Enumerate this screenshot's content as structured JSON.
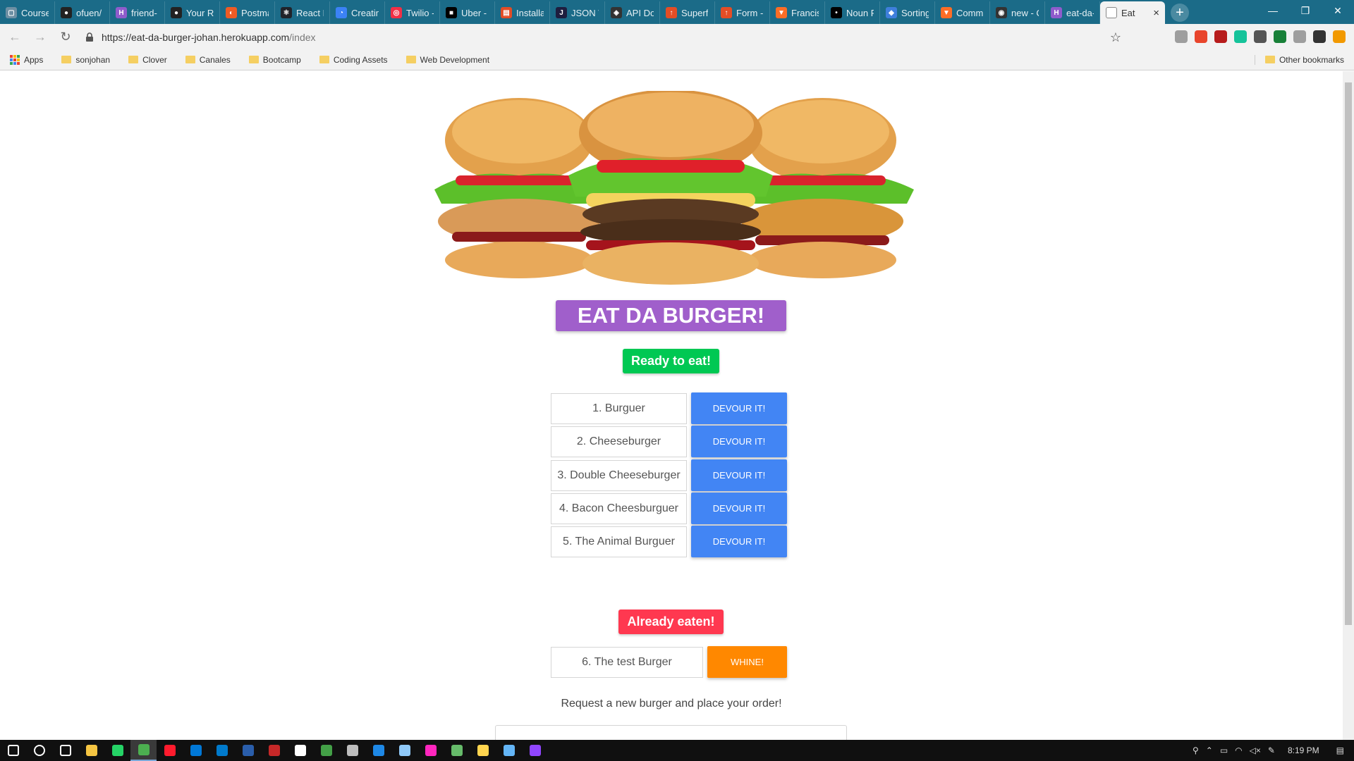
{
  "browser": {
    "tabs": [
      {
        "title": "Course",
        "color": "#6d8fa3",
        "glyph": "▢"
      },
      {
        "title": "ofuen/",
        "color": "#222222",
        "glyph": "●"
      },
      {
        "title": "friend-",
        "color": "#8f5ccc",
        "glyph": "H"
      },
      {
        "title": "Your Re",
        "color": "#222222",
        "glyph": "●"
      },
      {
        "title": "Postma",
        "color": "#ef5b25",
        "glyph": "◐"
      },
      {
        "title": "React R",
        "color": "#20232a",
        "glyph": "⚛"
      },
      {
        "title": "Creatin",
        "color": "#3b82f6",
        "glyph": "◔"
      },
      {
        "title": "Twilio -",
        "color": "#f22f46",
        "glyph": "◎"
      },
      {
        "title": "Uber -",
        "color": "#000000",
        "glyph": "■"
      },
      {
        "title": "Installa",
        "color": "#e34c26",
        "glyph": "▤"
      },
      {
        "title": "JSON V",
        "color": "#1e1e3f",
        "glyph": "J"
      },
      {
        "title": "API Do",
        "color": "#333333",
        "glyph": "◈"
      },
      {
        "title": "Superf",
        "color": "#e44d26",
        "glyph": "↑"
      },
      {
        "title": "Form -",
        "color": "#e44d26",
        "glyph": "↑"
      },
      {
        "title": "Francis",
        "color": "#fc6d26",
        "glyph": "▼"
      },
      {
        "title": "Noun P",
        "color": "#000000",
        "glyph": "•"
      },
      {
        "title": "Sorting",
        "color": "#3f7fdc",
        "glyph": "◆"
      },
      {
        "title": "Comm",
        "color": "#fc6d26",
        "glyph": "▼"
      },
      {
        "title": "new - C",
        "color": "#333333",
        "glyph": "◉"
      },
      {
        "title": "eat-da-",
        "color": "#8f5ccc",
        "glyph": "H"
      }
    ],
    "active_tab": {
      "title": "Eat",
      "close": "×"
    },
    "new_tab": "+",
    "window_controls": {
      "minimize": "—",
      "restore": "❐",
      "close": "✕"
    },
    "nav": {
      "back": "←",
      "forward": "→",
      "reload": "↻"
    },
    "url_main": "https://eat-da-burger-johan.herokuapp.com",
    "url_path": "/index",
    "bookmark_star": "☆",
    "bookmarks": [
      {
        "label": "Apps"
      },
      {
        "label": "sonjohan"
      },
      {
        "label": "Clover"
      },
      {
        "label": "Canales"
      },
      {
        "label": "Bootcamp"
      },
      {
        "label": "Coding Assets"
      },
      {
        "label": "Web Development"
      }
    ],
    "other_bookmarks": "Other bookmarks",
    "extension_colors": [
      "#9e9e9e",
      "#e8452c",
      "#b71c1c",
      "#15c39a",
      "#555555",
      "#188038",
      "#9e9e9e",
      "#333333",
      "#f29900"
    ]
  },
  "page": {
    "title": "EAT DA BURGER!",
    "ready_heading": "Ready to eat!",
    "eaten_heading": "Already eaten!",
    "devour_label": "DEVOUR IT!",
    "whine_label": "WHINE!",
    "ready_burgers": [
      {
        "name": "1. Burguer"
      },
      {
        "name": "2. Cheeseburger"
      },
      {
        "name": "3. Double Cheeseburger"
      },
      {
        "name": "4. Bacon Cheesburguer"
      },
      {
        "name": "5. The Animal Burguer"
      }
    ],
    "eaten_burgers": [
      {
        "name": "6. The test Burger"
      }
    ],
    "request_prompt": "Request a new burger and place your order!",
    "colors": {
      "title_bg": "#a05fcb",
      "ready_bg": "#00c853",
      "eaten_bg": "#ff3850",
      "devour_bg": "#4285f4",
      "whine_bg": "#ff8800"
    }
  },
  "taskbar": {
    "clock": "8:19 PM",
    "apps": [
      {
        "name": "windows-start",
        "color": "#ffffff"
      },
      {
        "name": "search",
        "color": "#ffffff"
      },
      {
        "name": "task-view",
        "color": "#ffffff"
      },
      {
        "name": "file-explorer",
        "color": "#f5c542"
      },
      {
        "name": "whatsapp",
        "color": "#25d366"
      },
      {
        "name": "chrome",
        "color": "#4caf50"
      },
      {
        "name": "opera",
        "color": "#ff1b2d"
      },
      {
        "name": "edge",
        "color": "#0078d7"
      },
      {
        "name": "vscode",
        "color": "#007acc"
      },
      {
        "name": "powershell",
        "color": "#2a5eab"
      },
      {
        "name": "app-red",
        "color": "#c62828"
      },
      {
        "name": "mail",
        "color": "#ffffff"
      },
      {
        "name": "app-green",
        "color": "#43a047"
      },
      {
        "name": "app-grey",
        "color": "#bdbdbd"
      },
      {
        "name": "app-blue",
        "color": "#1e88e5"
      },
      {
        "name": "notepad",
        "color": "#90caf9"
      },
      {
        "name": "adobe-xd",
        "color": "#ff26be"
      },
      {
        "name": "app-triangle",
        "color": "#66bb6a"
      },
      {
        "name": "app-stack",
        "color": "#ffd54f"
      },
      {
        "name": "app-monitor",
        "color": "#64b5f6"
      },
      {
        "name": "twitch",
        "color": "#9146ff"
      }
    ]
  }
}
